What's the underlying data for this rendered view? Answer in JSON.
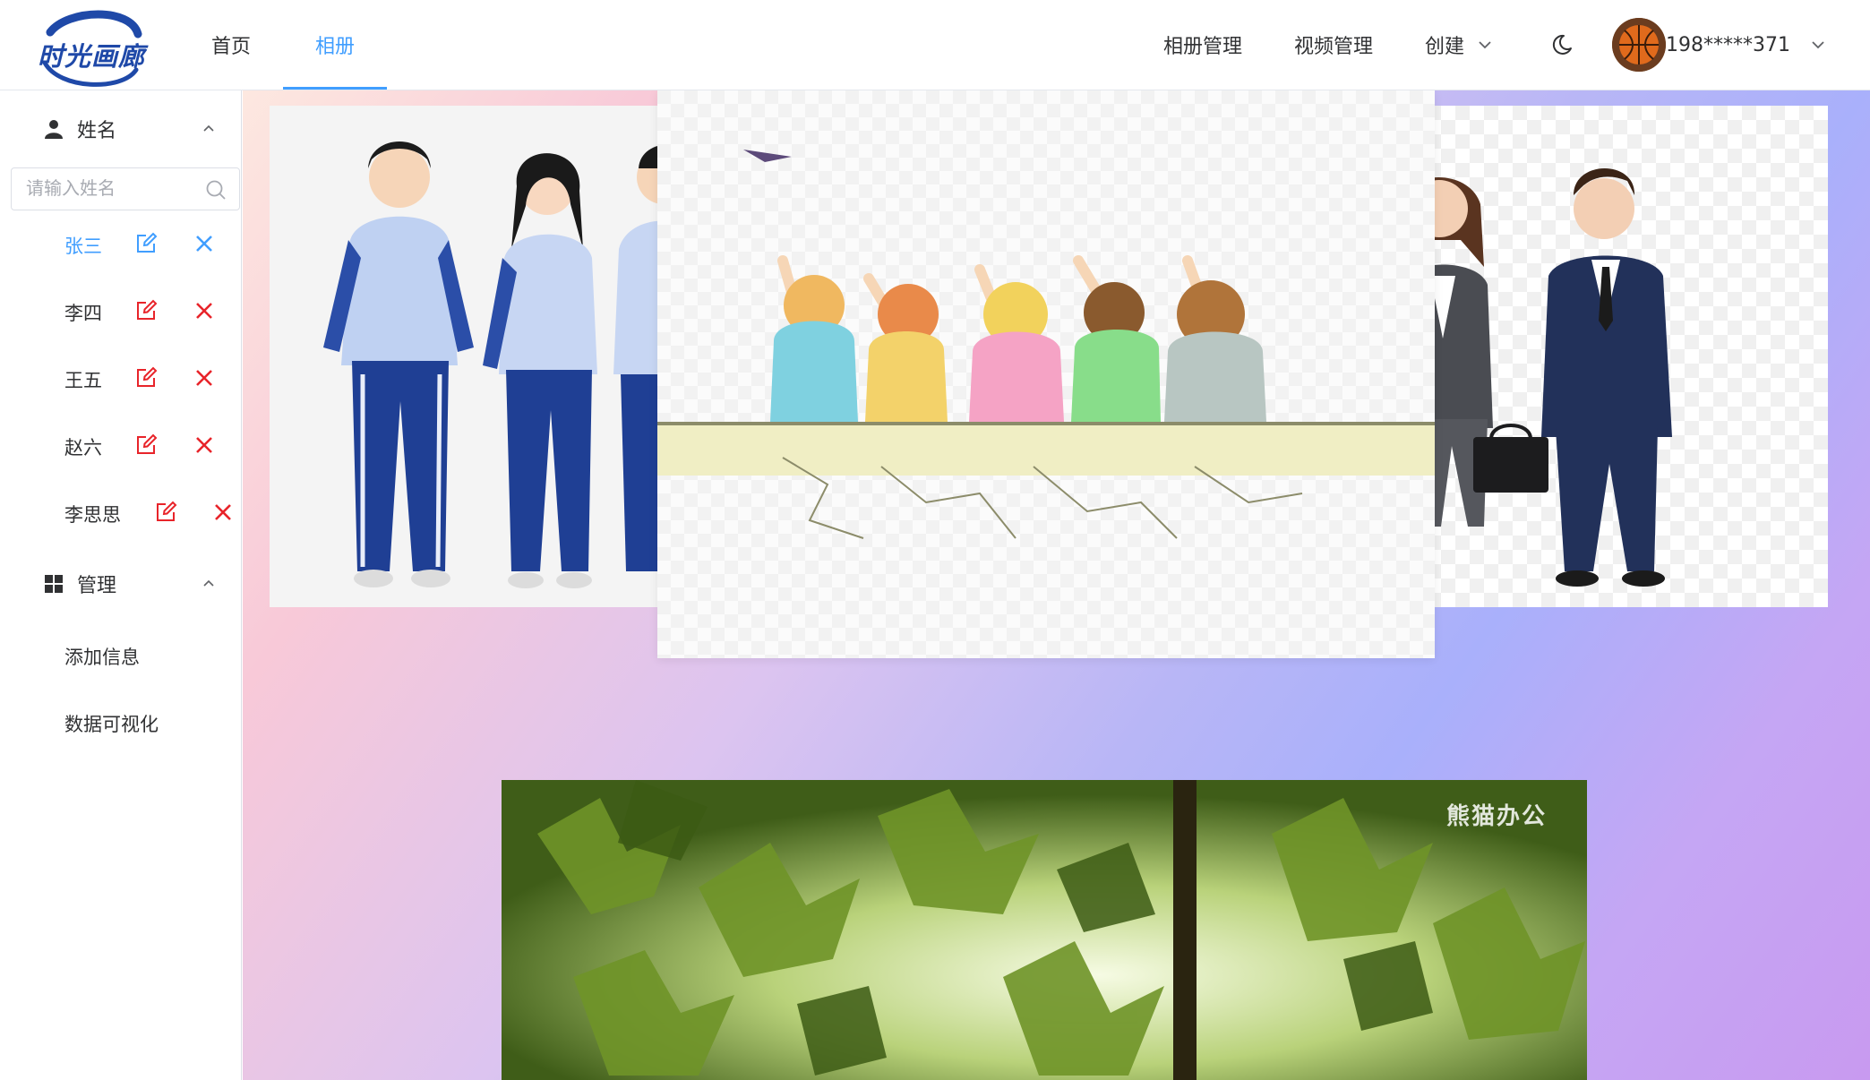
{
  "app": {
    "logo_text": "时光画廊"
  },
  "nav": {
    "left": [
      {
        "label": "首页"
      },
      {
        "label": "相册"
      }
    ],
    "right": {
      "album_manage": "相册管理",
      "video_manage": "视频管理",
      "create": "创建",
      "user_name": "198*****371"
    },
    "active": "相册"
  },
  "sidebar": {
    "names_section": {
      "title": "姓名",
      "search_placeholder": "请输入姓名",
      "search_value": "",
      "people": [
        {
          "name": "张三"
        },
        {
          "name": "李四"
        },
        {
          "name": "王五"
        },
        {
          "name": "赵六"
        },
        {
          "name": "李思思"
        }
      ],
      "selected": "张三"
    },
    "manage_section": {
      "title": "管理",
      "items": [
        {
          "label": "添加信息"
        },
        {
          "label": "数据可视化"
        }
      ]
    }
  },
  "gallery": {
    "cards": [
      {
        "name": "students-in-tracksuits-image"
      },
      {
        "name": "children-sitting-on-wall-image"
      },
      {
        "name": "business-people-image"
      },
      {
        "name": "green-leaves-image",
        "watermark": "熊猫办公"
      }
    ]
  },
  "colors": {
    "accent": "#409eff",
    "delete_red": "#e8242a",
    "text": "#303133"
  }
}
